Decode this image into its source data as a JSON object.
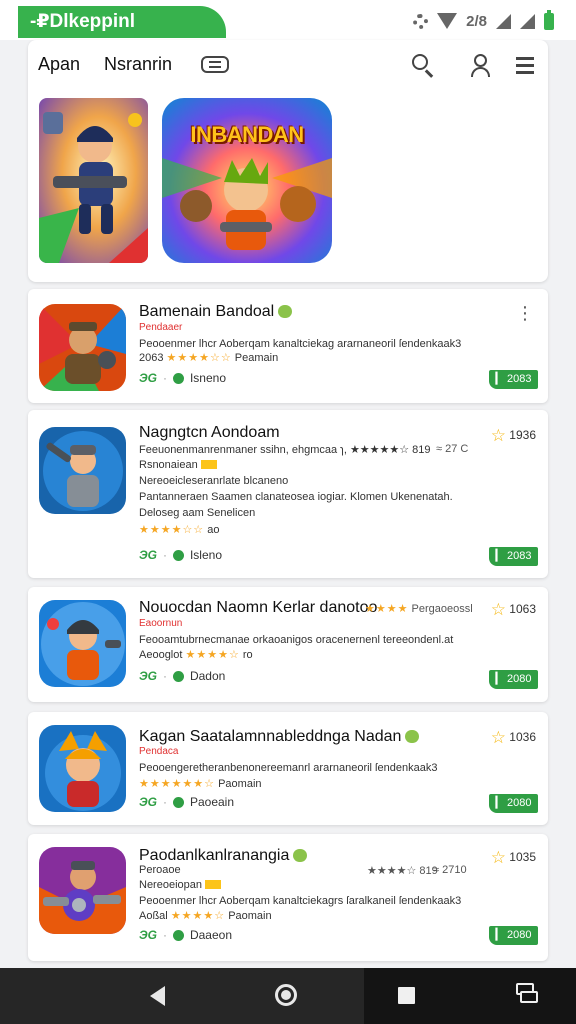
{
  "status_bar": {
    "label": "-₽Dlkeppinl",
    "signal_text": "2/8"
  },
  "header": {
    "tabs": [
      {
        "label": "Apan"
      },
      {
        "label": "Nsranrin"
      }
    ]
  },
  "featured": [
    {
      "title": ""
    },
    {
      "title": "INBANDAN"
    }
  ],
  "apps": [
    {
      "name": "Bamenain Bandoal",
      "badge": "",
      "tag": "Pendaaer",
      "desc": "Peooenmer lhcr Aoberqam kanaltciekag ararnaneoril ſendenkaak3",
      "rating_number": "2063",
      "stars": "★★★★☆☆",
      "rating_word": "Peamain",
      "foot_g": "ЭG",
      "foot_text": "Isneno",
      "install_label": "▎ 2083",
      "star_score": "",
      "more": "⋮"
    },
    {
      "name": "Nagngtcn Aondoam",
      "badge": "",
      "desc_top": "Feeuonenmanrenmaner ssihn, ehgmcaa ɿ, ★★★★★☆ 819",
      "rating_right": "≈ 27 C",
      "star_score": "1936",
      "tag": "Rsnonaiean",
      "line_2": "Nereoeicleseranrlate blcaneno",
      "line_3": "Pantanneraen Saamen clanateosea iogiar. Klomen Ukenenatah.",
      "line_4": "Deloseg aam Senelicen",
      "stars": "★★★★☆☆",
      "rating_word": "ao",
      "foot_g": "ЭG",
      "foot_text": "Isleno",
      "install_label": "▎ 2083"
    },
    {
      "name": "Nouocdan Naomn Kerlar danotoo",
      "badge": "",
      "tag": "Eaoornun",
      "right_stars": "★★★★",
      "right_text": "Pergaoeossl",
      "star_score": "1063",
      "desc": "Feooamtubrnecmanae orkaoanigos oracenernenl tereeondenl.at",
      "rating_number": "Aeooglot",
      "stars": "★★★★☆",
      "rating_word": "ro",
      "foot_g": "ЭG",
      "foot_text": "Dadon",
      "install_label": "▎ 2080"
    },
    {
      "name": "Kagan Saatalamnnableddnga Nadan",
      "badge": "",
      "tag": "Pendaca",
      "desc": "Peooengeretheranbenonereemanrl ararnaneoril ſendenkaak3",
      "stars": "★★★★★★☆",
      "rating_word": "Paomain",
      "star_score": "1036",
      "foot_g": "ЭG",
      "foot_text": "Paoeain",
      "install_label": "▎ 2080"
    },
    {
      "name": "Paodanlkanlranangia",
      "badge": "",
      "tag": "Peroaoe",
      "rating_right": "★★★★☆ 819",
      "rating_right_2": "≈ 2710",
      "star_score": "1035",
      "line_2": "Nereoeiopan",
      "desc": "Peooenmer lhcr Aoberqam kanaltciekagrs ſaralkaneil ſendenkaak3",
      "rating_number": "Aoßal",
      "stars": "★★★★☆",
      "rating_word": "Paomain",
      "foot_g": "ЭG",
      "foot_text": "Daaeon",
      "install_label": "▎ 2080"
    }
  ]
}
